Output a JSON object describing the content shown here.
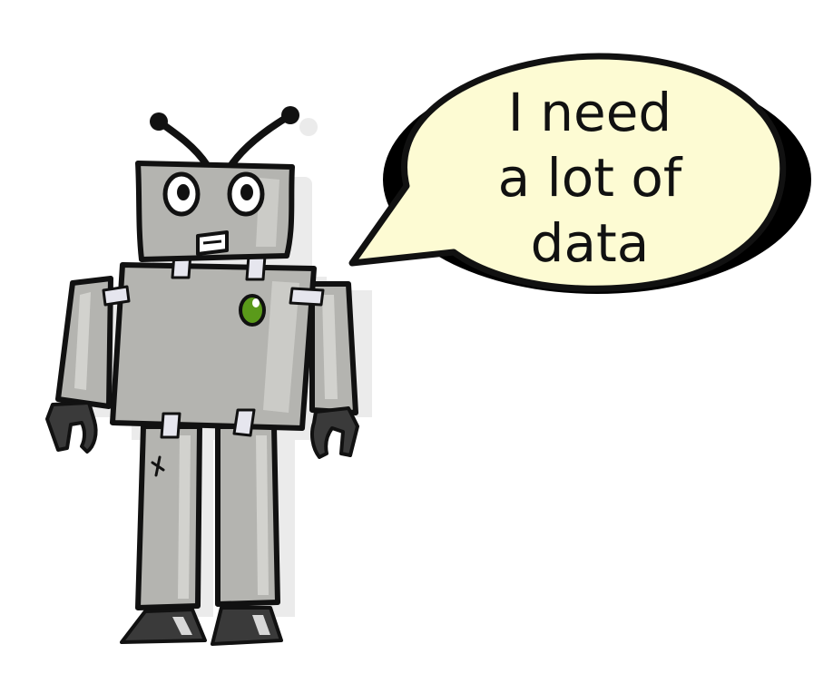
{
  "speech_bubble": {
    "lines": [
      "I need",
      "a lot of",
      "data"
    ]
  },
  "colors": {
    "robot_body": "#b4b4b0",
    "robot_shadow": "#e9e9e9",
    "outline": "#111111",
    "bubble_fill": "#fdfbd3",
    "bubble_shadow": "#000000",
    "button": "#5a9a1a",
    "tape": "#e6e6ee",
    "claw": "#3a3a3a"
  }
}
